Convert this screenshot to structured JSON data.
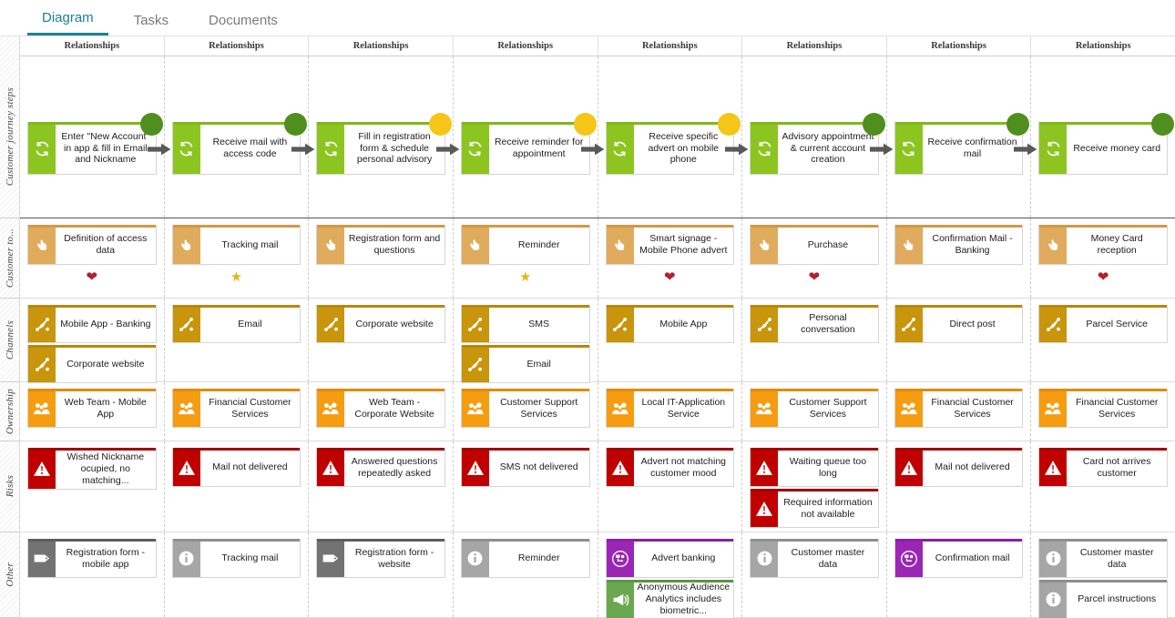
{
  "tabs": [
    {
      "label": "Diagram",
      "active": true
    },
    {
      "label": "Tasks",
      "active": false
    },
    {
      "label": "Documents",
      "active": false
    }
  ],
  "column_header_label": "Relationships",
  "column_count": 8,
  "row_labels": [
    "Customer journey steps",
    "Customer to...",
    "Channels",
    "Ownership",
    "Risks",
    "Other"
  ],
  "colors": {
    "step_green": "#8cc520",
    "step_green_bar": "#7fb818",
    "dot_dark_green": "#4f8f1e",
    "dot_yellow": "#f5c518",
    "touch_sand": "#e0ab5c",
    "channel_gold": "#c8950c",
    "owner_orange": "#f59c11",
    "risk_red": "#c00000",
    "other_grey_dark": "#737373",
    "other_grey_light": "#a6a6a6",
    "other_purple": "#9b26b6",
    "other_green": "#6aa84f",
    "tab_active": "#1a8296",
    "heart_red": "#b41f2e",
    "star_gold": "#e8b41c"
  },
  "rows": {
    "journey_steps": [
      {
        "label": "Enter \"New Account\" in app & fill in Email and Nickname",
        "dot": "dark_green",
        "icon": "cycle-icon",
        "arrow": true
      },
      {
        "label": "Receive mail with access code",
        "dot": "dark_green",
        "icon": "cycle-icon",
        "arrow": true
      },
      {
        "label": "Fill in registration form & schedule personal advisory",
        "dot": "yellow",
        "icon": "cycle-icon",
        "arrow": true
      },
      {
        "label": "Receive reminder for  appointment",
        "dot": "yellow",
        "icon": "cycle-icon",
        "arrow": true
      },
      {
        "label": "Receive specific advert on mobile phone",
        "dot": "yellow",
        "icon": "cycle-icon",
        "arrow": true
      },
      {
        "label": "Advisory appointment & current account creation",
        "dot": "dark_green",
        "icon": "cycle-icon",
        "arrow": true
      },
      {
        "label": "Receive confirmation mail",
        "dot": "dark_green",
        "icon": "cycle-icon",
        "arrow": true
      },
      {
        "label": "Receive money card",
        "dot": "dark_green",
        "icon": "cycle-icon",
        "arrow": false
      }
    ],
    "customer_touchpoints": [
      {
        "label": "Definition of access data",
        "marker": "heart"
      },
      {
        "label": "Tracking mail",
        "marker": "star"
      },
      {
        "label": "Registration form and questions",
        "marker": "none"
      },
      {
        "label": "Reminder",
        "marker": "star"
      },
      {
        "label": "Smart signage - Mobile Phone advert",
        "marker": "heart"
      },
      {
        "label": "Purchase",
        "marker": "heart"
      },
      {
        "label": "Confirmation Mail - Banking",
        "marker": "none"
      },
      {
        "label": "Money Card reception",
        "marker": "heart"
      }
    ],
    "channels": [
      [
        "Mobile App - Banking",
        "Corporate website"
      ],
      [
        "Email"
      ],
      [
        "Corporate website"
      ],
      [
        "SMS",
        "Email"
      ],
      [
        "Mobile App"
      ],
      [
        "Personal conversation"
      ],
      [
        "Direct post"
      ],
      [
        "Parcel Service"
      ]
    ],
    "ownership": [
      [
        "Web Team - Mobile App"
      ],
      [
        "Financial Customer Services"
      ],
      [
        "Web Team - Corporate Website"
      ],
      [
        "Customer Support Services"
      ],
      [
        "Local IT-Application Service"
      ],
      [
        "Customer Support Services"
      ],
      [
        "Financial Customer Services"
      ],
      [
        "Financial Customer Services"
      ]
    ],
    "risks": [
      [
        "Wished Nickname ocupied, no matching..."
      ],
      [
        "Mail not delivered"
      ],
      [
        "Answered questions repeatedly asked"
      ],
      [
        "SMS not delivered"
      ],
      [
        "Advert not matching customer mood"
      ],
      [
        "Waiting queue too long",
        "Required information not available"
      ],
      [
        "Mail not delivered"
      ],
      [
        "Card not arrives customer"
      ]
    ],
    "other": [
      [
        {
          "label": "Registration form - mobile app",
          "kind": "tag"
        }
      ],
      [
        {
          "label": "Tracking mail",
          "kind": "info"
        }
      ],
      [
        {
          "label": "Registration form - website",
          "kind": "tag"
        }
      ],
      [
        {
          "label": "Reminder",
          "kind": "info"
        }
      ],
      [
        {
          "label": "Advert banking",
          "kind": "process"
        },
        {
          "label": "Anonymous Audience Analytics includes biometric...",
          "kind": "megaphone"
        }
      ],
      [
        {
          "label": "Customer master data",
          "kind": "info"
        }
      ],
      [
        {
          "label": "Confirmation mail",
          "kind": "process"
        }
      ],
      [
        {
          "label": "Customer master data",
          "kind": "info"
        },
        {
          "label": "Parcel instructions",
          "kind": "info"
        }
      ]
    ]
  }
}
